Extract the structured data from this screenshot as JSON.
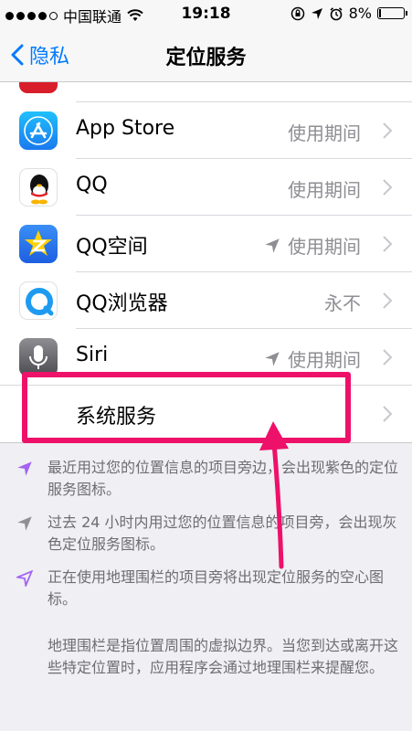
{
  "status_bar": {
    "carrier": "中国联通",
    "time": "19:18",
    "battery": "8%",
    "battery_level": 0.08
  },
  "nav": {
    "back_label": "隐私",
    "title": "定位服务"
  },
  "apps": [
    {
      "label": "App Store",
      "detail": "使用期间",
      "icon": "app-store-icon",
      "recent": false
    },
    {
      "label": "QQ",
      "detail": "使用期间",
      "icon": "qq-icon",
      "recent": false
    },
    {
      "label": "QQ空间",
      "detail": "使用期间",
      "icon": "qzone-icon",
      "recent": true
    },
    {
      "label": "QQ浏览器",
      "detail": "永不",
      "icon": "qq-browser-icon",
      "recent": false
    },
    {
      "label": "Siri",
      "detail": "使用期间",
      "icon": "siri-icon",
      "recent": true
    }
  ],
  "system_services": {
    "label": "系统服务"
  },
  "legend": [
    {
      "text": "最近用过您的位置信息的项目旁边，会出现紫色的定位服务图标。",
      "color": "#a463f2"
    },
    {
      "text": "过去 24 小时内用过您的位置信息的项目旁，会出现灰色定位服务图标。",
      "color": "#8e8e93"
    },
    {
      "text": "正在使用地理围栏的项目旁将出现定位服务的空心图标。",
      "color": "#a463f2"
    }
  ],
  "explanation": "地理围栏是指位置周围的虚拟边界。当您到达或离开这些特定位置时，应用程序会通过地理围栏来提醒您。",
  "colors": {
    "accent": "#007aff",
    "highlight": "#ee1169"
  }
}
